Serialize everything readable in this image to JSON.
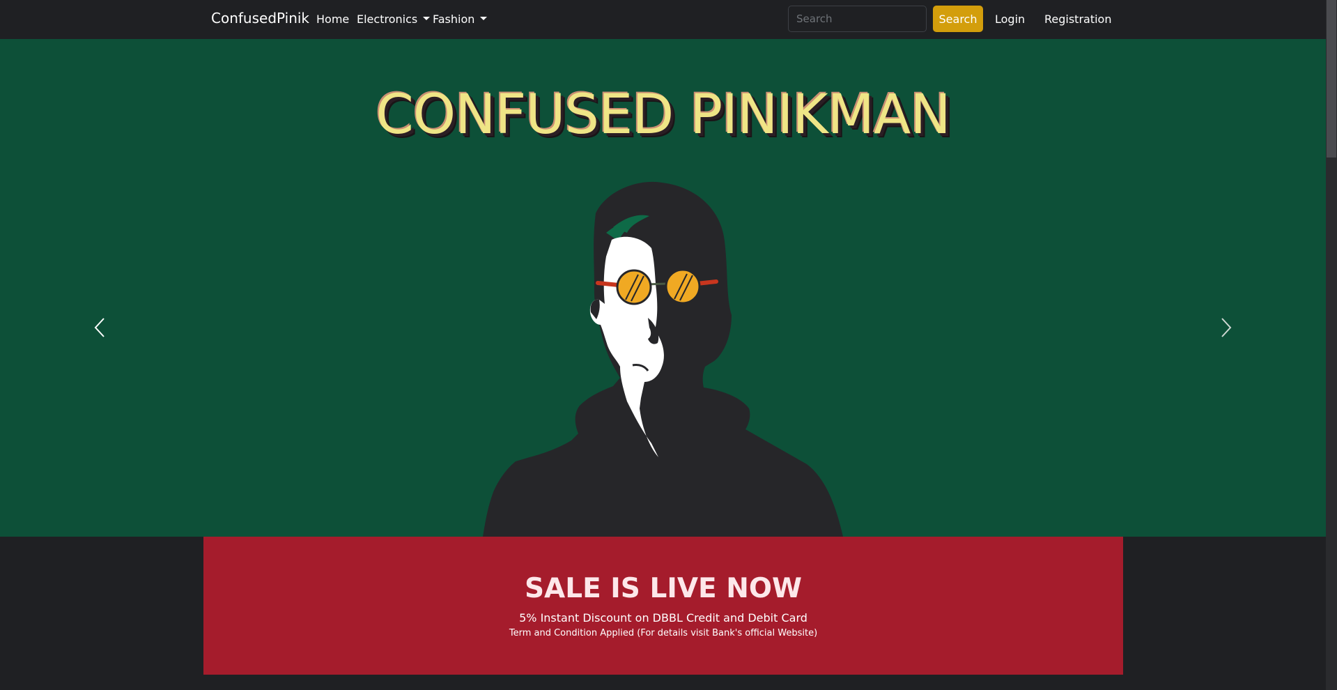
{
  "navbar": {
    "brand": "ConfusedPinik",
    "links": [
      "Home",
      "Electronics",
      "Fashion"
    ],
    "search": {
      "placeholder": "Search",
      "value": ""
    },
    "search_button": "Search",
    "login": "Login",
    "registration": "Registration"
  },
  "hero": {
    "title": "CONFUSED PINIKMAN",
    "prev_icon": "chevron-left-icon",
    "next_icon": "chevron-right-icon"
  },
  "sale": {
    "title": "SALE IS LIVE NOW",
    "line1": "5% Instant Discount on DBBL Credit and Debit Card",
    "line2": "Term and Condition Applied (For details visit Bank's official Website)"
  },
  "colors": {
    "navbar_bg": "#1f2023",
    "hero_bg": "#0d5038",
    "search_button": "#d39e0c",
    "sale_bg": "#a51c2c",
    "title_yellow": "#efe586"
  }
}
